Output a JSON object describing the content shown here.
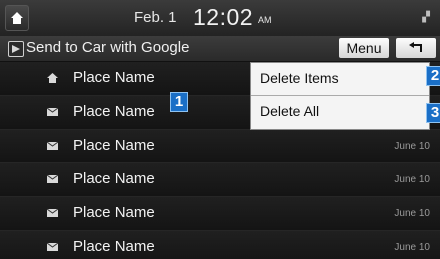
{
  "status": {
    "date": "Feb.  1",
    "time": "12:02",
    "ampm": "AM"
  },
  "title": {
    "text": "Send to Car with Google",
    "menu_label": "Menu"
  },
  "list": [
    {
      "label": "Place Name",
      "date": "",
      "icon": "home-icon"
    },
    {
      "label": "Place Name",
      "date": "",
      "icon": "envelope-icon"
    },
    {
      "label": "Place Name",
      "date": "June 10",
      "icon": "envelope-icon"
    },
    {
      "label": "Place Name",
      "date": "June 10",
      "icon": "envelope-icon"
    },
    {
      "label": "Place Name",
      "date": "June 10",
      "icon": "envelope-icon"
    },
    {
      "label": "Place Name",
      "date": "June 10",
      "icon": "envelope-icon"
    }
  ],
  "popup": {
    "delete_items": "Delete Items",
    "delete_all": "Delete All"
  },
  "callouts": {
    "c1": "1",
    "c2": "2",
    "c3": "3"
  },
  "colors": {
    "callout_blue": "#1a6fc7",
    "background": "#161616"
  }
}
